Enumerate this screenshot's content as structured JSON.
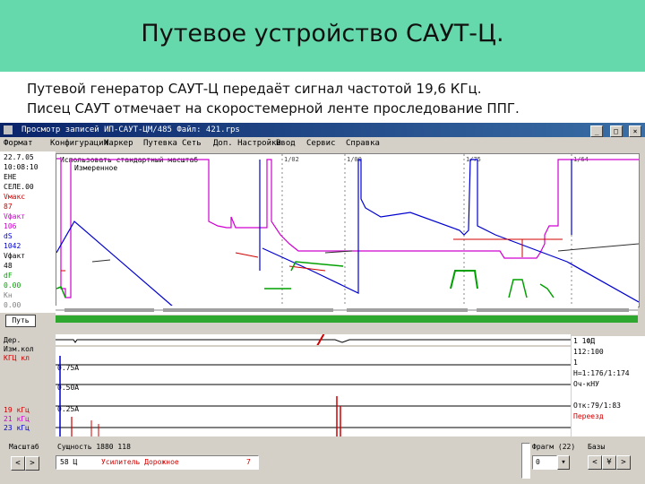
{
  "slide": {
    "title": "Путевое устройство САУТ-Ц.",
    "line1": "Путевой генератор САУТ-Ц передаёт сигнал частотой 19,6 КГц.",
    "line2": "Писец САУТ отмечает на скоростемерной ленте проследование  ППГ."
  },
  "app": {
    "window_title": "Просмотр записей ИП-САУТ-ЦМ/485    Файл: 421.rps",
    "controls": [
      "_",
      "□",
      "×"
    ],
    "menu": [
      "Формат",
      "Конфигурация",
      "Маркер",
      "Путевка",
      "Сеть",
      "Доп. Настройки",
      "Ввод",
      "Сервис",
      "Справка"
    ],
    "left_params": [
      {
        "text": "22.7.05",
        "color": "#000000"
      },
      {
        "text": "10:08:10",
        "color": "#000000"
      },
      {
        "text": "ЕНЕ",
        "color": "#000000"
      },
      {
        "text": "СЕЛЕ.00",
        "color": "#000000"
      },
      {
        "text": "Vмакс",
        "color": "#d00000"
      },
      {
        "text": "87",
        "color": "#d00000"
      },
      {
        "text": "Vфакт",
        "color": "#d000d0"
      },
      {
        "text": "106",
        "color": "#d000d0"
      },
      {
        "text": "dS",
        "color": "#0000d0"
      },
      {
        "text": "1042",
        "color": "#0000d0"
      },
      {
        "text": "Vфакт",
        "color": "#000000"
      },
      {
        "text": "48",
        "color": "#000000"
      },
      {
        "text": "dF",
        "color": "#00a000"
      },
      {
        "text": "0.00",
        "color": "#00a000"
      },
      {
        "text": "Кн",
        "color": "#808080"
      },
      {
        "text": "0.00",
        "color": "#808080"
      }
    ],
    "chart_header": "Использовать стандартный масштаб\nИзмеренное",
    "tick_labels": [
      "1/02",
      "1/00",
      "1/75",
      "1/64"
    ],
    "put_button": "Путь",
    "bottom_left": [
      {
        "text": "Дер.",
        "color": "#000000"
      },
      {
        "text": "Изм.кол",
        "color": "#000000"
      },
      {
        "text": "КГЦ кл",
        "color": "#d00000"
      },
      {
        "text": "19 кГц",
        "color": "#d00000"
      },
      {
        "text": "21 кГц",
        "color": "#d000d0"
      },
      {
        "text": "23 кГц",
        "color": "#0000d0"
      }
    ],
    "level_labels": [
      "0.75А",
      "0.50А",
      "0.25А"
    ],
    "right_info": [
      {
        "text": "1 1ФД",
        "color": "#000000"
      },
      {
        "text": "112:100",
        "color": "#000000"
      },
      {
        "text": "1",
        "color": "#000000"
      },
      {
        "text": "Н=1:176/1:174",
        "color": "#000000"
      },
      {
        "text": "Оч-кНУ",
        "color": "#000000"
      },
      {
        "text": "",
        "color": "#000000"
      },
      {
        "text": "Отк:79/1:83",
        "color": "#000000"
      },
      {
        "text": "Переезд",
        "color": "#d00000"
      }
    ],
    "status": {
      "scale_label": "Масштаб",
      "coord_label": "Сущность 1880 118",
      "field_code": "58 Ц",
      "field_text": "Усилитель  Дорожное",
      "field_mark": "7",
      "frame_label": "Фрагм (22)",
      "frame_value": "0",
      "mode_label": "Базы"
    }
  }
}
